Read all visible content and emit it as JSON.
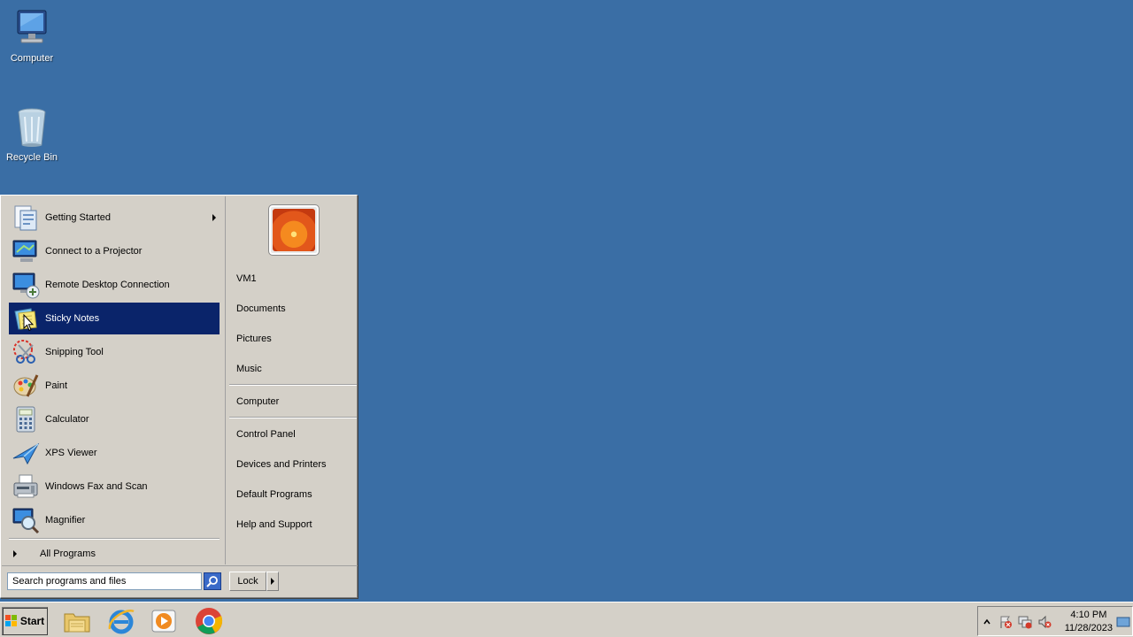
{
  "desktop": {
    "icons": [
      {
        "label": "Computer",
        "icon": "computer-icon"
      },
      {
        "label": "Recycle Bin",
        "icon": "recycle-bin-icon"
      }
    ]
  },
  "start_menu": {
    "programs": [
      {
        "label": "Getting Started",
        "icon": "getting-started-icon",
        "has_submenu": true
      },
      {
        "label": "Connect to a Projector",
        "icon": "projector-icon"
      },
      {
        "label": "Remote Desktop Connection",
        "icon": "remote-desktop-icon"
      },
      {
        "label": "Sticky Notes",
        "icon": "sticky-notes-icon",
        "selected": true
      },
      {
        "label": "Snipping Tool",
        "icon": "snipping-tool-icon"
      },
      {
        "label": "Paint",
        "icon": "paint-icon"
      },
      {
        "label": "Calculator",
        "icon": "calculator-icon"
      },
      {
        "label": "XPS Viewer",
        "icon": "xps-viewer-icon"
      },
      {
        "label": "Windows Fax and Scan",
        "icon": "fax-scan-icon"
      },
      {
        "label": "Magnifier",
        "icon": "magnifier-icon"
      }
    ],
    "all_programs": "All Programs",
    "right_links": {
      "user": "VM1",
      "documents": "Documents",
      "pictures": "Pictures",
      "music": "Music",
      "computer": "Computer",
      "control_panel": "Control Panel",
      "devices_printers": "Devices and Printers",
      "default_programs": "Default Programs",
      "help_support": "Help and Support"
    },
    "search_placeholder": "Search programs and files",
    "lock_label": "Lock"
  },
  "taskbar": {
    "start_label": "Start",
    "pinned": [
      "file-explorer-icon",
      "internet-explorer-icon",
      "media-player-icon",
      "chrome-icon"
    ],
    "clock": {
      "time": "4:10 PM",
      "date": "11/28/2023"
    }
  },
  "colors": {
    "desktop": "#3a6ea5",
    "menu_bg": "#d4d0c8",
    "selection": "#0a246a"
  }
}
